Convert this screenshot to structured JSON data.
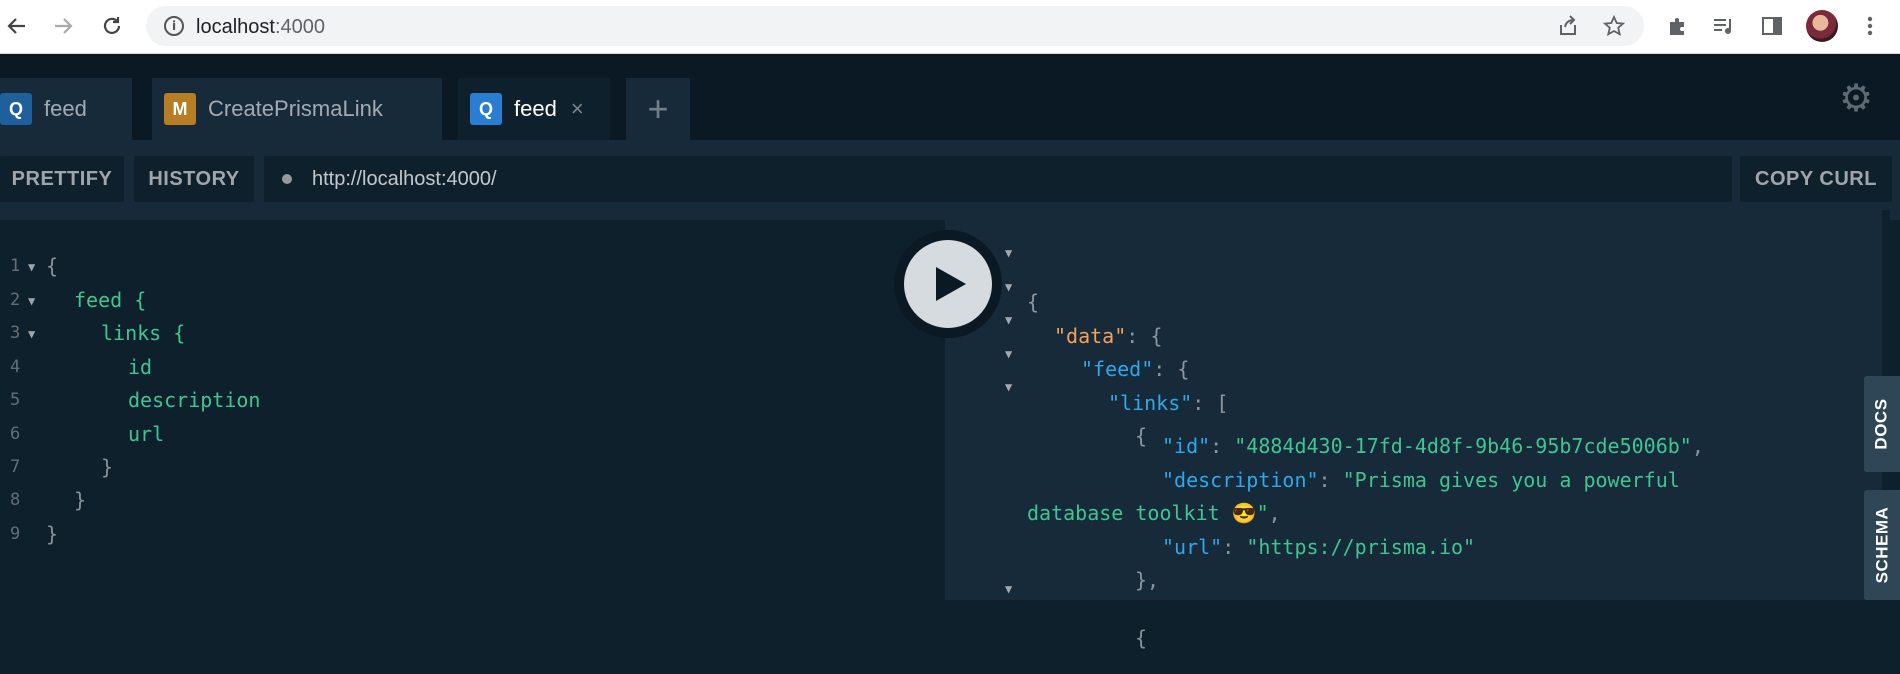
{
  "browser": {
    "back_icon": "arrow-left-icon",
    "forward_icon": "arrow-right-icon",
    "reload_icon": "reload-icon",
    "address_host": "localhost",
    "address_port": ":4000",
    "share_icon": "share-icon",
    "star_icon": "star-icon",
    "extensions_icon": "puzzle-icon",
    "media_icon": "media-queue-icon",
    "sidepanel_icon": "side-panel-icon",
    "menu_icon": "kebab-menu-icon"
  },
  "tabs": [
    {
      "badge": "Q",
      "label": "feed",
      "active": false
    },
    {
      "badge": "M",
      "label": "CreatePrismaLink",
      "active": false
    },
    {
      "badge": "Q",
      "label": "feed",
      "active": true,
      "close": "×"
    }
  ],
  "add_tab": "+",
  "settings_icon": "gear-icon",
  "toolbar": {
    "prettify": "PRETTIFY",
    "history": "HISTORY",
    "endpoint": "http://localhost:4000/",
    "copy_curl": "COPY CURL"
  },
  "editor": {
    "lines": [
      {
        "num": "1",
        "text": "{",
        "brace": true,
        "fold": true
      },
      {
        "num": "2",
        "text": "feed {",
        "fold": true
      },
      {
        "num": "3",
        "text": "links {",
        "fold": true
      },
      {
        "num": "4",
        "text": "id"
      },
      {
        "num": "5",
        "text": "description"
      },
      {
        "num": "6",
        "text": "url"
      },
      {
        "num": "7",
        "text": "}",
        "brace": true
      },
      {
        "num": "8",
        "text": "}",
        "brace": true
      },
      {
        "num": "9",
        "text": "}",
        "brace": true
      }
    ]
  },
  "result": {
    "l1": "{",
    "l2_key": "\"data\"",
    "l2_rest": ": {",
    "l3_key": "\"feed\"",
    "l3_rest": ": {",
    "l4_key": "\"links\"",
    "l4_rest": ": [",
    "l5": "{",
    "l6_key": "\"id\"",
    "l6_sep": ": ",
    "l6_val": "\"4884d430-17fd-4d8f-9b46-95b7cde5006b\"",
    "l6_end": ",",
    "l7_key": "\"description\"",
    "l7_sep": ": ",
    "l7_val": "\"Prisma gives you a powerful",
    "l8_val": "database toolkit 😎\"",
    "l8_end": ",",
    "l9_key": "\"url\"",
    "l9_sep": ": ",
    "l9_val": "\"https://prisma.io\"",
    "l10": "},",
    "l11": "{"
  },
  "side": {
    "docs": "DOCS",
    "schema": "SCHEMA"
  },
  "run_icon": "play-icon"
}
